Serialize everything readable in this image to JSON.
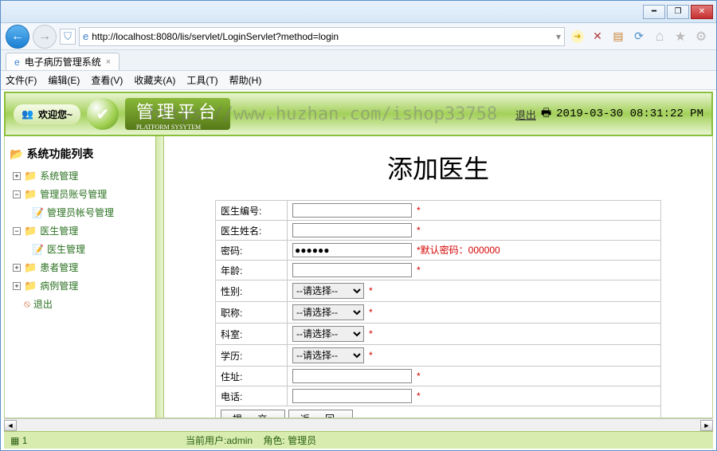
{
  "browser": {
    "url": "http://localhost:8080/lis/servlet/LoginServlet?method=login",
    "tab_title": "电子病历管理系统"
  },
  "menubar": {
    "file": "文件(F)",
    "edit": "编辑(E)",
    "view": "查看(V)",
    "favorites": "收藏夹(A)",
    "tools": "工具(T)",
    "help": "帮助(H)"
  },
  "header": {
    "welcome": "欢迎您~",
    "banner_title": "管理平台",
    "banner_sub": "PLATFORM SYSYTEM",
    "watermark": "https://www.huzhan.com/ishop33758",
    "exit_label": "退出",
    "timestamp": "2019-03-30 08:31:22 PM"
  },
  "sidebar": {
    "title": "系统功能列表",
    "items": [
      {
        "label": "系统管理",
        "level": 1,
        "toggle": "+",
        "icon": "folder"
      },
      {
        "label": "管理员账号管理",
        "level": 1,
        "toggle": "−",
        "icon": "folder"
      },
      {
        "label": "管理员帐号管理",
        "level": 2,
        "icon": "file"
      },
      {
        "label": "医生管理",
        "level": 1,
        "toggle": "−",
        "icon": "folder"
      },
      {
        "label": "医生管理",
        "level": 2,
        "icon": "file"
      },
      {
        "label": "患者管理",
        "level": 1,
        "toggle": "+",
        "icon": "folder"
      },
      {
        "label": "病例管理",
        "level": 1,
        "toggle": "+",
        "icon": "folder"
      },
      {
        "label": "退出",
        "level": 1,
        "toggle": "",
        "icon": "exit"
      }
    ]
  },
  "form": {
    "title": "添加医生",
    "fields": {
      "doctor_id": {
        "label": "医生编号:",
        "value": "",
        "required": "*"
      },
      "doctor_name": {
        "label": "医生姓名:",
        "value": "",
        "required": "*"
      },
      "password": {
        "label": "密码:",
        "value": "●●●●●●",
        "required": "",
        "hint": "*默认密码：000000"
      },
      "age": {
        "label": "年龄:",
        "value": "",
        "required": "*"
      },
      "gender": {
        "label": "性别:",
        "selected": "--请选择--",
        "required": "*"
      },
      "title": {
        "label": "职称:",
        "selected": "--请选择--",
        "required": "*"
      },
      "dept": {
        "label": "科室:",
        "selected": "--请选择--",
        "required": "*"
      },
      "education": {
        "label": "学历:",
        "selected": "--请选择--",
        "required": "*"
      },
      "address": {
        "label": "住址:",
        "value": "",
        "required": "*"
      },
      "phone": {
        "label": "电话:",
        "value": "",
        "required": "*"
      }
    },
    "buttons": {
      "submit": "提 交",
      "back": "返 回"
    }
  },
  "statusbar": {
    "left": "1",
    "user_label": "当前用户:",
    "user": "admin",
    "role_label": "角色:",
    "role": "管理员"
  }
}
